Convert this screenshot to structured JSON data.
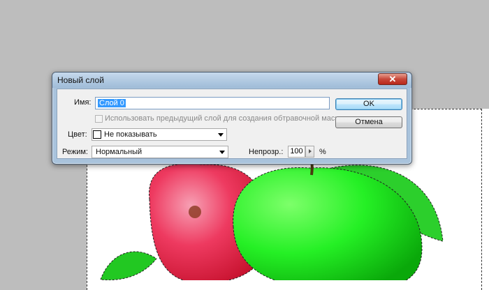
{
  "dialog": {
    "title": "Новый слой",
    "close_glyph": "✕",
    "name_label": "Имя:",
    "name_value": "Слой 0",
    "clipping_mask_label": "Использовать предыдущий слой для создания обтравочной маски",
    "color_label": "Цвет:",
    "color_value": "Не показывать",
    "mode_label": "Режим:",
    "mode_value": "Нормальный",
    "opacity_label": "Непрозр.:",
    "opacity_value": "100",
    "opacity_unit": "%",
    "ok_label": "OK",
    "cancel_label": "Отмена"
  },
  "colors": {
    "workspace": "#bdbdbd",
    "red_apple": "#e8304a",
    "green_apple": "#1ee31e",
    "leaf": "#22d122",
    "selection": "#3399ff"
  },
  "icons": {
    "close": "close-icon",
    "dropdown": "chevron-down-icon",
    "slider": "triangle-right-icon"
  }
}
